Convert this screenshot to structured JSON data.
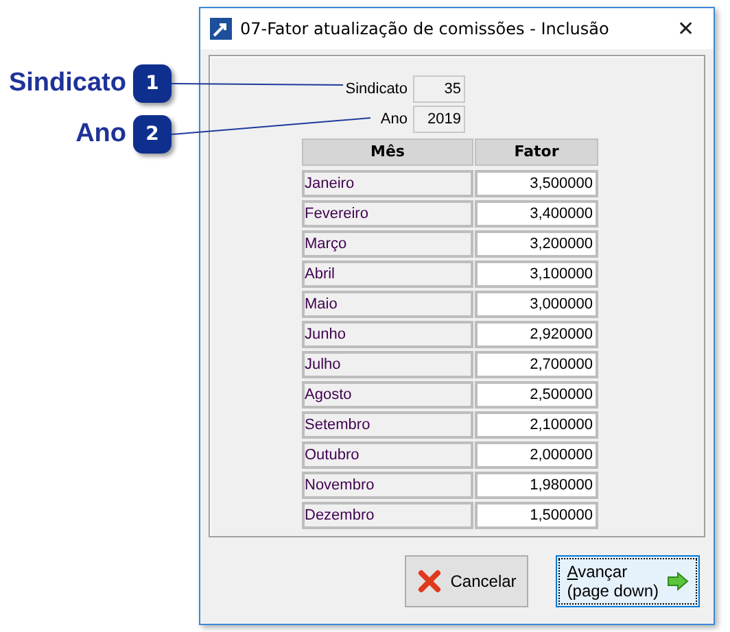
{
  "callouts": [
    {
      "label": "Sindicato",
      "number": "1"
    },
    {
      "label": "Ano",
      "number": "2"
    }
  ],
  "window": {
    "title": "07-Fator atualização de comissões - Inclusão",
    "close": "✕"
  },
  "fields": [
    {
      "label": "Sindicato",
      "value": "35"
    },
    {
      "label": "Ano",
      "value": "2019"
    }
  ],
  "table": {
    "columns": [
      "Mês",
      "Fator"
    ],
    "rows": [
      [
        "Janeiro",
        "3,500000"
      ],
      [
        "Fevereiro",
        "3,400000"
      ],
      [
        "Março",
        "3,200000"
      ],
      [
        "Abril",
        "3,100000"
      ],
      [
        "Maio",
        "3,000000"
      ],
      [
        "Junho",
        "2,920000"
      ],
      [
        "Julho",
        "2,700000"
      ],
      [
        "Agosto",
        "2,500000"
      ],
      [
        "Setembro",
        "2,100000"
      ],
      [
        "Outubro",
        "2,000000"
      ],
      [
        "Novembro",
        "1,980000"
      ],
      [
        "Dezembro",
        "1,500000"
      ]
    ]
  },
  "buttons": [
    {
      "kind": "cancel",
      "label": "Cancelar",
      "selected": false
    },
    {
      "kind": "next",
      "label": "Avançar\n(page down)",
      "selected": true
    }
  ]
}
